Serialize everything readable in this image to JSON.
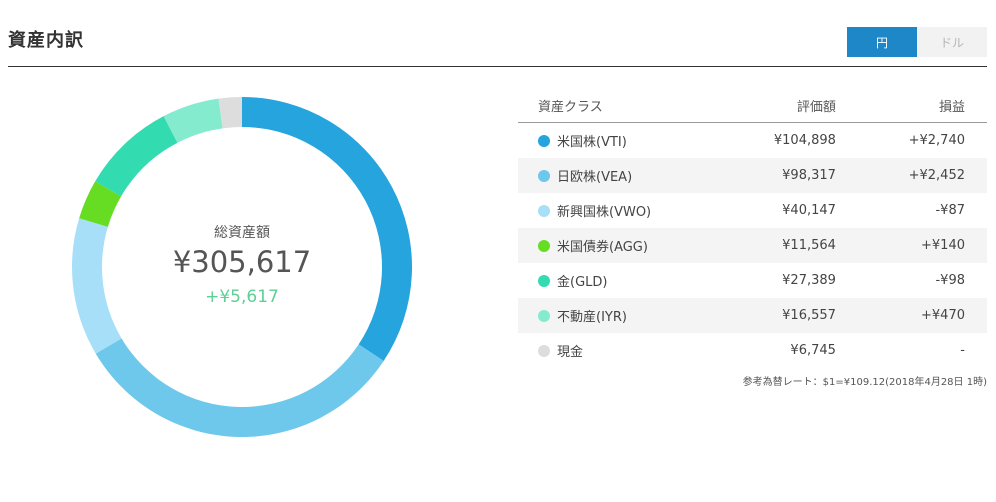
{
  "header": {
    "title": "資産内訳",
    "currency_toggle": {
      "yen_label": "円",
      "dollar_label": "ドル",
      "selected": "円"
    }
  },
  "summary": {
    "label": "総資産額",
    "total": "¥305,617",
    "gain": "+¥5,617"
  },
  "table": {
    "headers": {
      "asset_class": "資産クラス",
      "valuation": "評価額",
      "gain": "損益"
    },
    "rows": [
      {
        "name": "米国株(VTI)",
        "value": "¥104,898",
        "gain": "+¥2,740",
        "gain_type": "pos",
        "color": "#26a4dd",
        "amount": 104898
      },
      {
        "name": "日欧株(VEA)",
        "value": "¥98,317",
        "gain": "+¥2,452",
        "gain_type": "pos",
        "color": "#6ec8eb",
        "amount": 98317
      },
      {
        "name": "新興国株(VWO)",
        "value": "¥40,147",
        "gain": "-¥87",
        "gain_type": "neg",
        "color": "#a7dff8",
        "amount": 40147
      },
      {
        "name": "米国債券(AGG)",
        "value": "¥11,564",
        "gain": "+¥140",
        "gain_type": "pos",
        "color": "#66dd22",
        "amount": 11564
      },
      {
        "name": "金(GLD)",
        "value": "¥27,389",
        "gain": "-¥98",
        "gain_type": "neg",
        "color": "#33dbb0",
        "amount": 27389
      },
      {
        "name": "不動産(IYR)",
        "value": "¥16,557",
        "gain": "+¥470",
        "gain_type": "pos",
        "color": "#84ebcf",
        "amount": 16557
      },
      {
        "name": "現金",
        "value": "¥6,745",
        "gain": "-",
        "gain_type": "none",
        "color": "#dddddd",
        "amount": 6745
      }
    ]
  },
  "footnote": "参考為替レート：$1=¥109.12(2018年4月28日 1時)"
}
